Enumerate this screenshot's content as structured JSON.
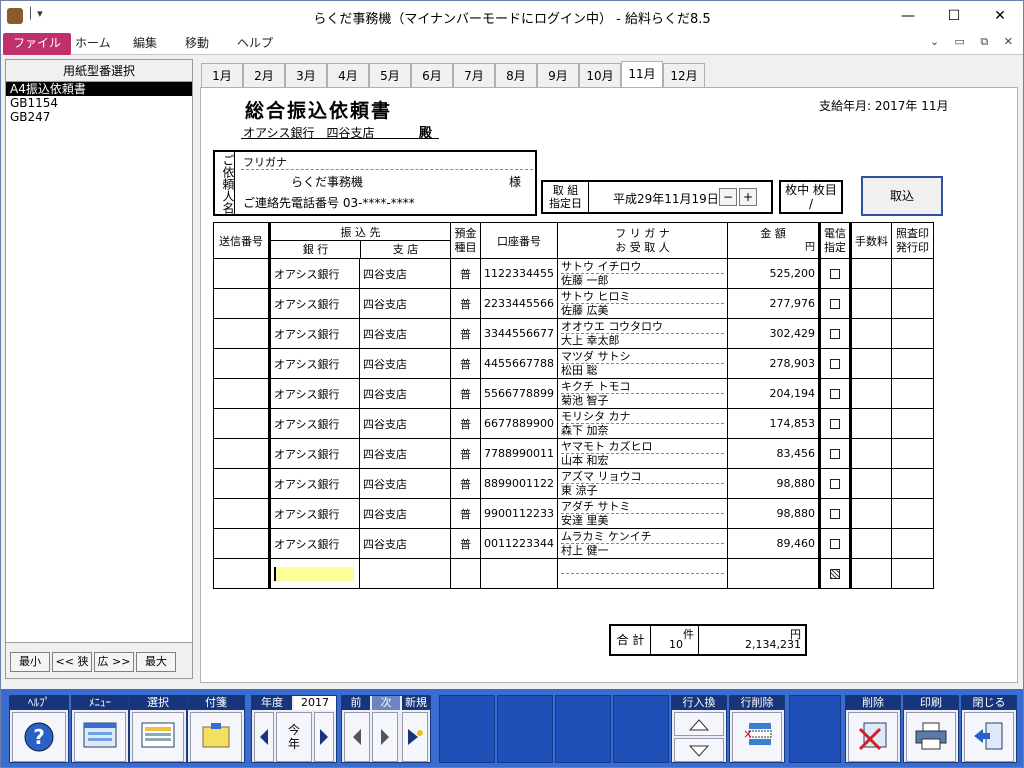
{
  "window": {
    "title": "らくだ事務機（マイナンバーモードにログイン中） - 給料らくだ8.5",
    "controls": [
      "minimize",
      "maximize",
      "close"
    ]
  },
  "ribbon": {
    "tabs": [
      "ファイル",
      "ホーム",
      "編集",
      "移動",
      "ヘルプ"
    ]
  },
  "left_pane": {
    "header": "用紙型番選択",
    "items": [
      "A4振込依頼書",
      "GB1154",
      "GB247"
    ],
    "selected_index": 0,
    "buttons": [
      "最小",
      "<< 狭",
      "広 >>",
      "最大"
    ]
  },
  "months": {
    "tabs": [
      "1月",
      "2月",
      "3月",
      "4月",
      "5月",
      "6月",
      "7月",
      "8月",
      "9月",
      "10月",
      "11月",
      "12月"
    ],
    "active_index": 10
  },
  "document": {
    "title": "総合振込依頼書",
    "bank_line": "オアシス銀行　四谷支店",
    "dono": "殿",
    "pay_month": "支給年月: 2017年 11月",
    "requester": {
      "vertical_label": "ご依頼人名",
      "furigana_label": "フリガナ",
      "name": "らくだ事務機",
      "sama": "様",
      "tel": "ご連絡先電話番号  03-****-****"
    },
    "date": {
      "label_1": "取 組",
      "label_2": "指定日",
      "value": "平成29年11月19日",
      "minus": "−",
      "plus": "+"
    },
    "count": {
      "label": "枚中 枚目",
      "value": "/"
    },
    "torikomi_button": "取込",
    "table_headers": {
      "send_no": "送信番号",
      "furikomi": "振 込 先",
      "bank": "銀 行",
      "branch": "支 店",
      "kind_1": "預金",
      "kind_2": "種目",
      "account": "口座番号",
      "kana": "フ リ ガ ナ",
      "payee": "お 受 取 人",
      "amount": "金 額",
      "yen": "円",
      "denshin_1": "電信",
      "denshin_2": "指定",
      "fee": "手数料",
      "stamp_1": "照査印",
      "stamp_2": "発行印"
    },
    "rows": [
      {
        "bank": "オアシス銀行",
        "branch": "四谷支店",
        "kind": "普",
        "account": "1122334455",
        "kana": "サトウ イチロウ",
        "name": "佐藤 一郎",
        "amount": "525,200"
      },
      {
        "bank": "オアシス銀行",
        "branch": "四谷支店",
        "kind": "普",
        "account": "2233445566",
        "kana": "サトウ ヒロミ",
        "name": "佐藤 広美",
        "amount": "277,976"
      },
      {
        "bank": "オアシス銀行",
        "branch": "四谷支店",
        "kind": "普",
        "account": "3344556677",
        "kana": "オオウエ コウタロウ",
        "name": "大上 幸太郎",
        "amount": "302,429"
      },
      {
        "bank": "オアシス銀行",
        "branch": "四谷支店",
        "kind": "普",
        "account": "4455667788",
        "kana": "マツダ サトシ",
        "name": "松田 聡",
        "amount": "278,903"
      },
      {
        "bank": "オアシス銀行",
        "branch": "四谷支店",
        "kind": "普",
        "account": "5566778899",
        "kana": "キクチ トモコ",
        "name": "菊池 智子",
        "amount": "204,194"
      },
      {
        "bank": "オアシス銀行",
        "branch": "四谷支店",
        "kind": "普",
        "account": "6677889900",
        "kana": "モリシタ カナ",
        "name": "森下 加奈",
        "amount": "174,853"
      },
      {
        "bank": "オアシス銀行",
        "branch": "四谷支店",
        "kind": "普",
        "account": "7788990011",
        "kana": "ヤマモト カズヒロ",
        "name": "山本 和宏",
        "amount": "83,456"
      },
      {
        "bank": "オアシス銀行",
        "branch": "四谷支店",
        "kind": "普",
        "account": "8899001122",
        "kana": "アズマ リョウコ",
        "name": "東 涼子",
        "amount": "98,880"
      },
      {
        "bank": "オアシス銀行",
        "branch": "四谷支店",
        "kind": "普",
        "account": "9900112233",
        "kana": "アダチ サトミ",
        "name": "安達 里美",
        "amount": "98,880"
      },
      {
        "bank": "オアシス銀行",
        "branch": "四谷支店",
        "kind": "普",
        "account": "0011223344",
        "kana": "ムラカミ ケンイチ",
        "name": "村上 健一",
        "amount": "89,460"
      }
    ],
    "totals": {
      "label": "合 計",
      "ken": "件",
      "count": "10",
      "yen": "円",
      "amount": "2,134,231"
    }
  },
  "toolbar": {
    "help": "ﾍﾙﾌﾟ",
    "menu": "ﾒﾆｭｰ",
    "select": "選択",
    "fusen": "付箋",
    "nendo": "年度",
    "year": "2017",
    "this_year_1": "今",
    "this_year_2": "年",
    "prev": "前",
    "next": "次",
    "new": "新規",
    "row_swap": "行入換",
    "row_delete": "行削除",
    "delete": "削除",
    "print": "印刷",
    "close": "閉じる"
  }
}
